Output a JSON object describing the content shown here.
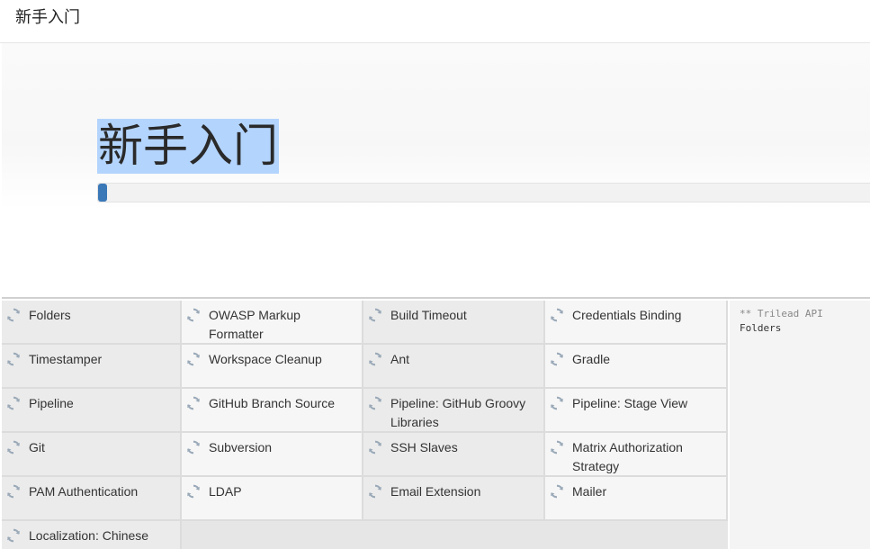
{
  "header": {
    "title": "新手入门"
  },
  "hero": {
    "title": "新手入门",
    "progress": 0.012
  },
  "plugins": [
    "Folders",
    "OWASP Markup Formatter",
    "Build Timeout",
    "Credentials Binding",
    "Timestamper",
    "Workspace Cleanup",
    "Ant",
    "Gradle",
    "Pipeline",
    "GitHub Branch Source",
    "Pipeline: GitHub Groovy Libraries",
    "Pipeline: Stage View",
    "Git",
    "Subversion",
    "SSH Slaves",
    "Matrix Authorization Strategy",
    "PAM Authentication",
    "LDAP",
    "Email Extension",
    "Mailer",
    "Localization: Chinese"
  ],
  "plugin_icon": "refresh-icon",
  "log": {
    "lines": [
      "** Trilead API",
      "Folders"
    ]
  },
  "colors": {
    "accent": "#3a78b8",
    "selection": "#b3d4fd",
    "icon": "#9aa9b8"
  }
}
